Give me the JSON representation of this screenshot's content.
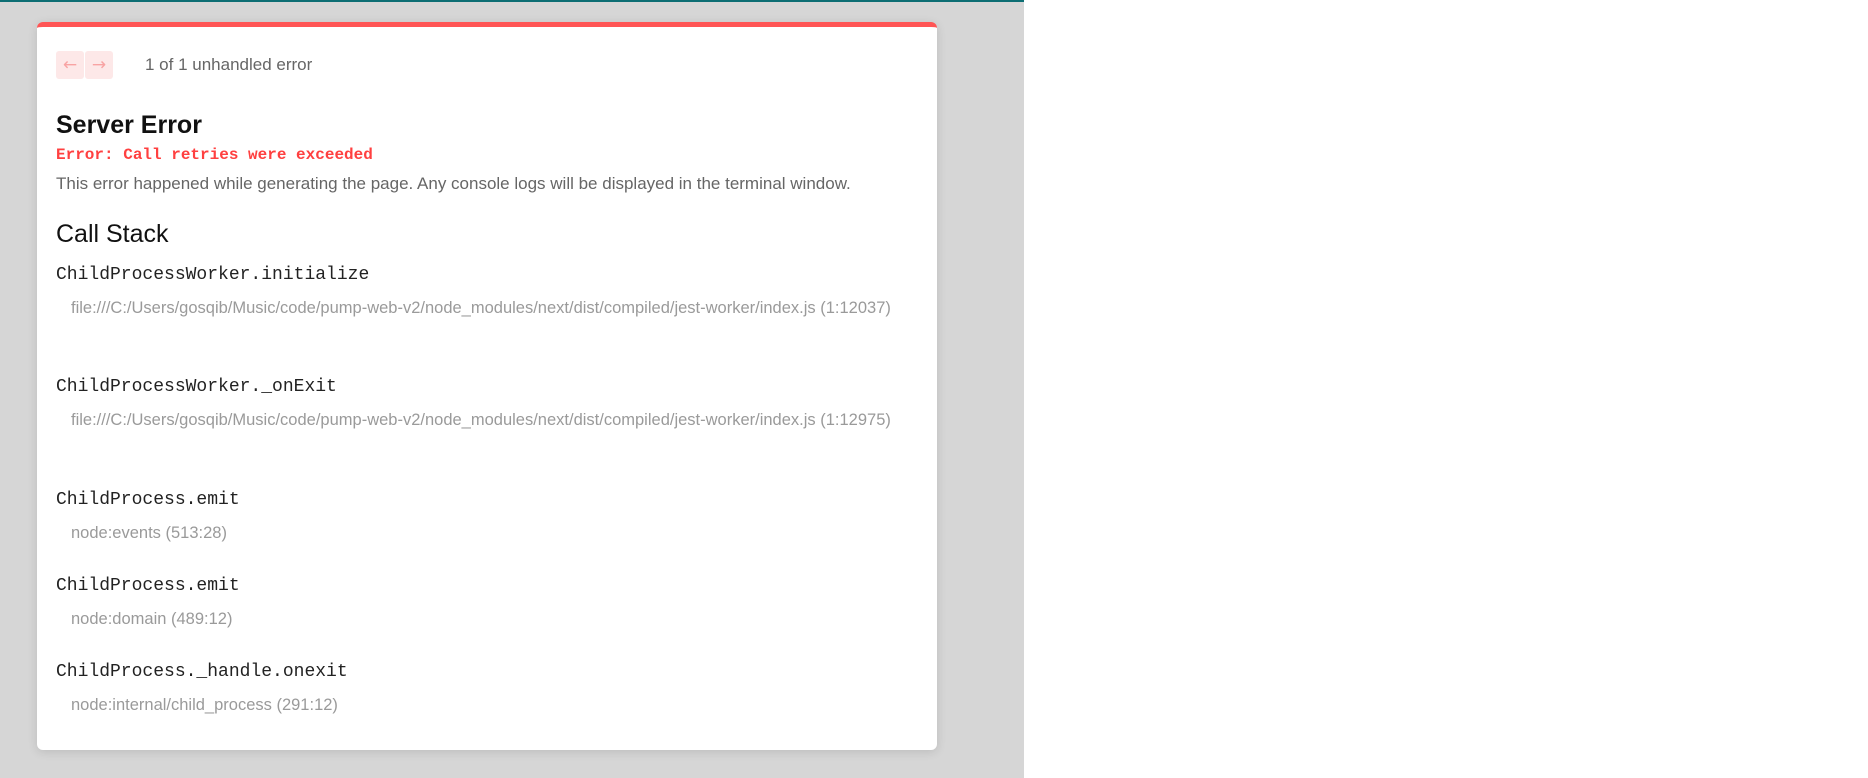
{
  "overlay": {
    "nav": {
      "prev_icon": "arrow-left-icon",
      "next_icon": "arrow-right-icon",
      "count_text": "1 of 1 unhandled error"
    },
    "title": "Server Error",
    "message": "Error: Call retries were exceeded",
    "description": "This error happened while generating the page. Any console logs will be displayed in the terminal window.",
    "call_stack_title": "Call Stack",
    "frames": [
      {
        "fn": "ChildProcessWorker.initialize",
        "loc": "file:///C:/Users/gosqib/Music/code/pump-web-v2/node_modules/next/dist/compiled/jest-worker/index.js (1:12037)"
      },
      {
        "fn": "ChildProcessWorker._onExit",
        "loc": "file:///C:/Users/gosqib/Music/code/pump-web-v2/node_modules/next/dist/compiled/jest-worker/index.js (1:12975)"
      },
      {
        "fn": "ChildProcess.emit",
        "loc": "node:events (513:28)"
      },
      {
        "fn": "ChildProcess.emit",
        "loc": "node:domain (489:12)"
      },
      {
        "fn": "ChildProcess._handle.onexit",
        "loc": "node:internal/child_process (291:12)"
      }
    ],
    "colors": {
      "accent": "#ff5555",
      "error_text": "#ff4040"
    }
  }
}
